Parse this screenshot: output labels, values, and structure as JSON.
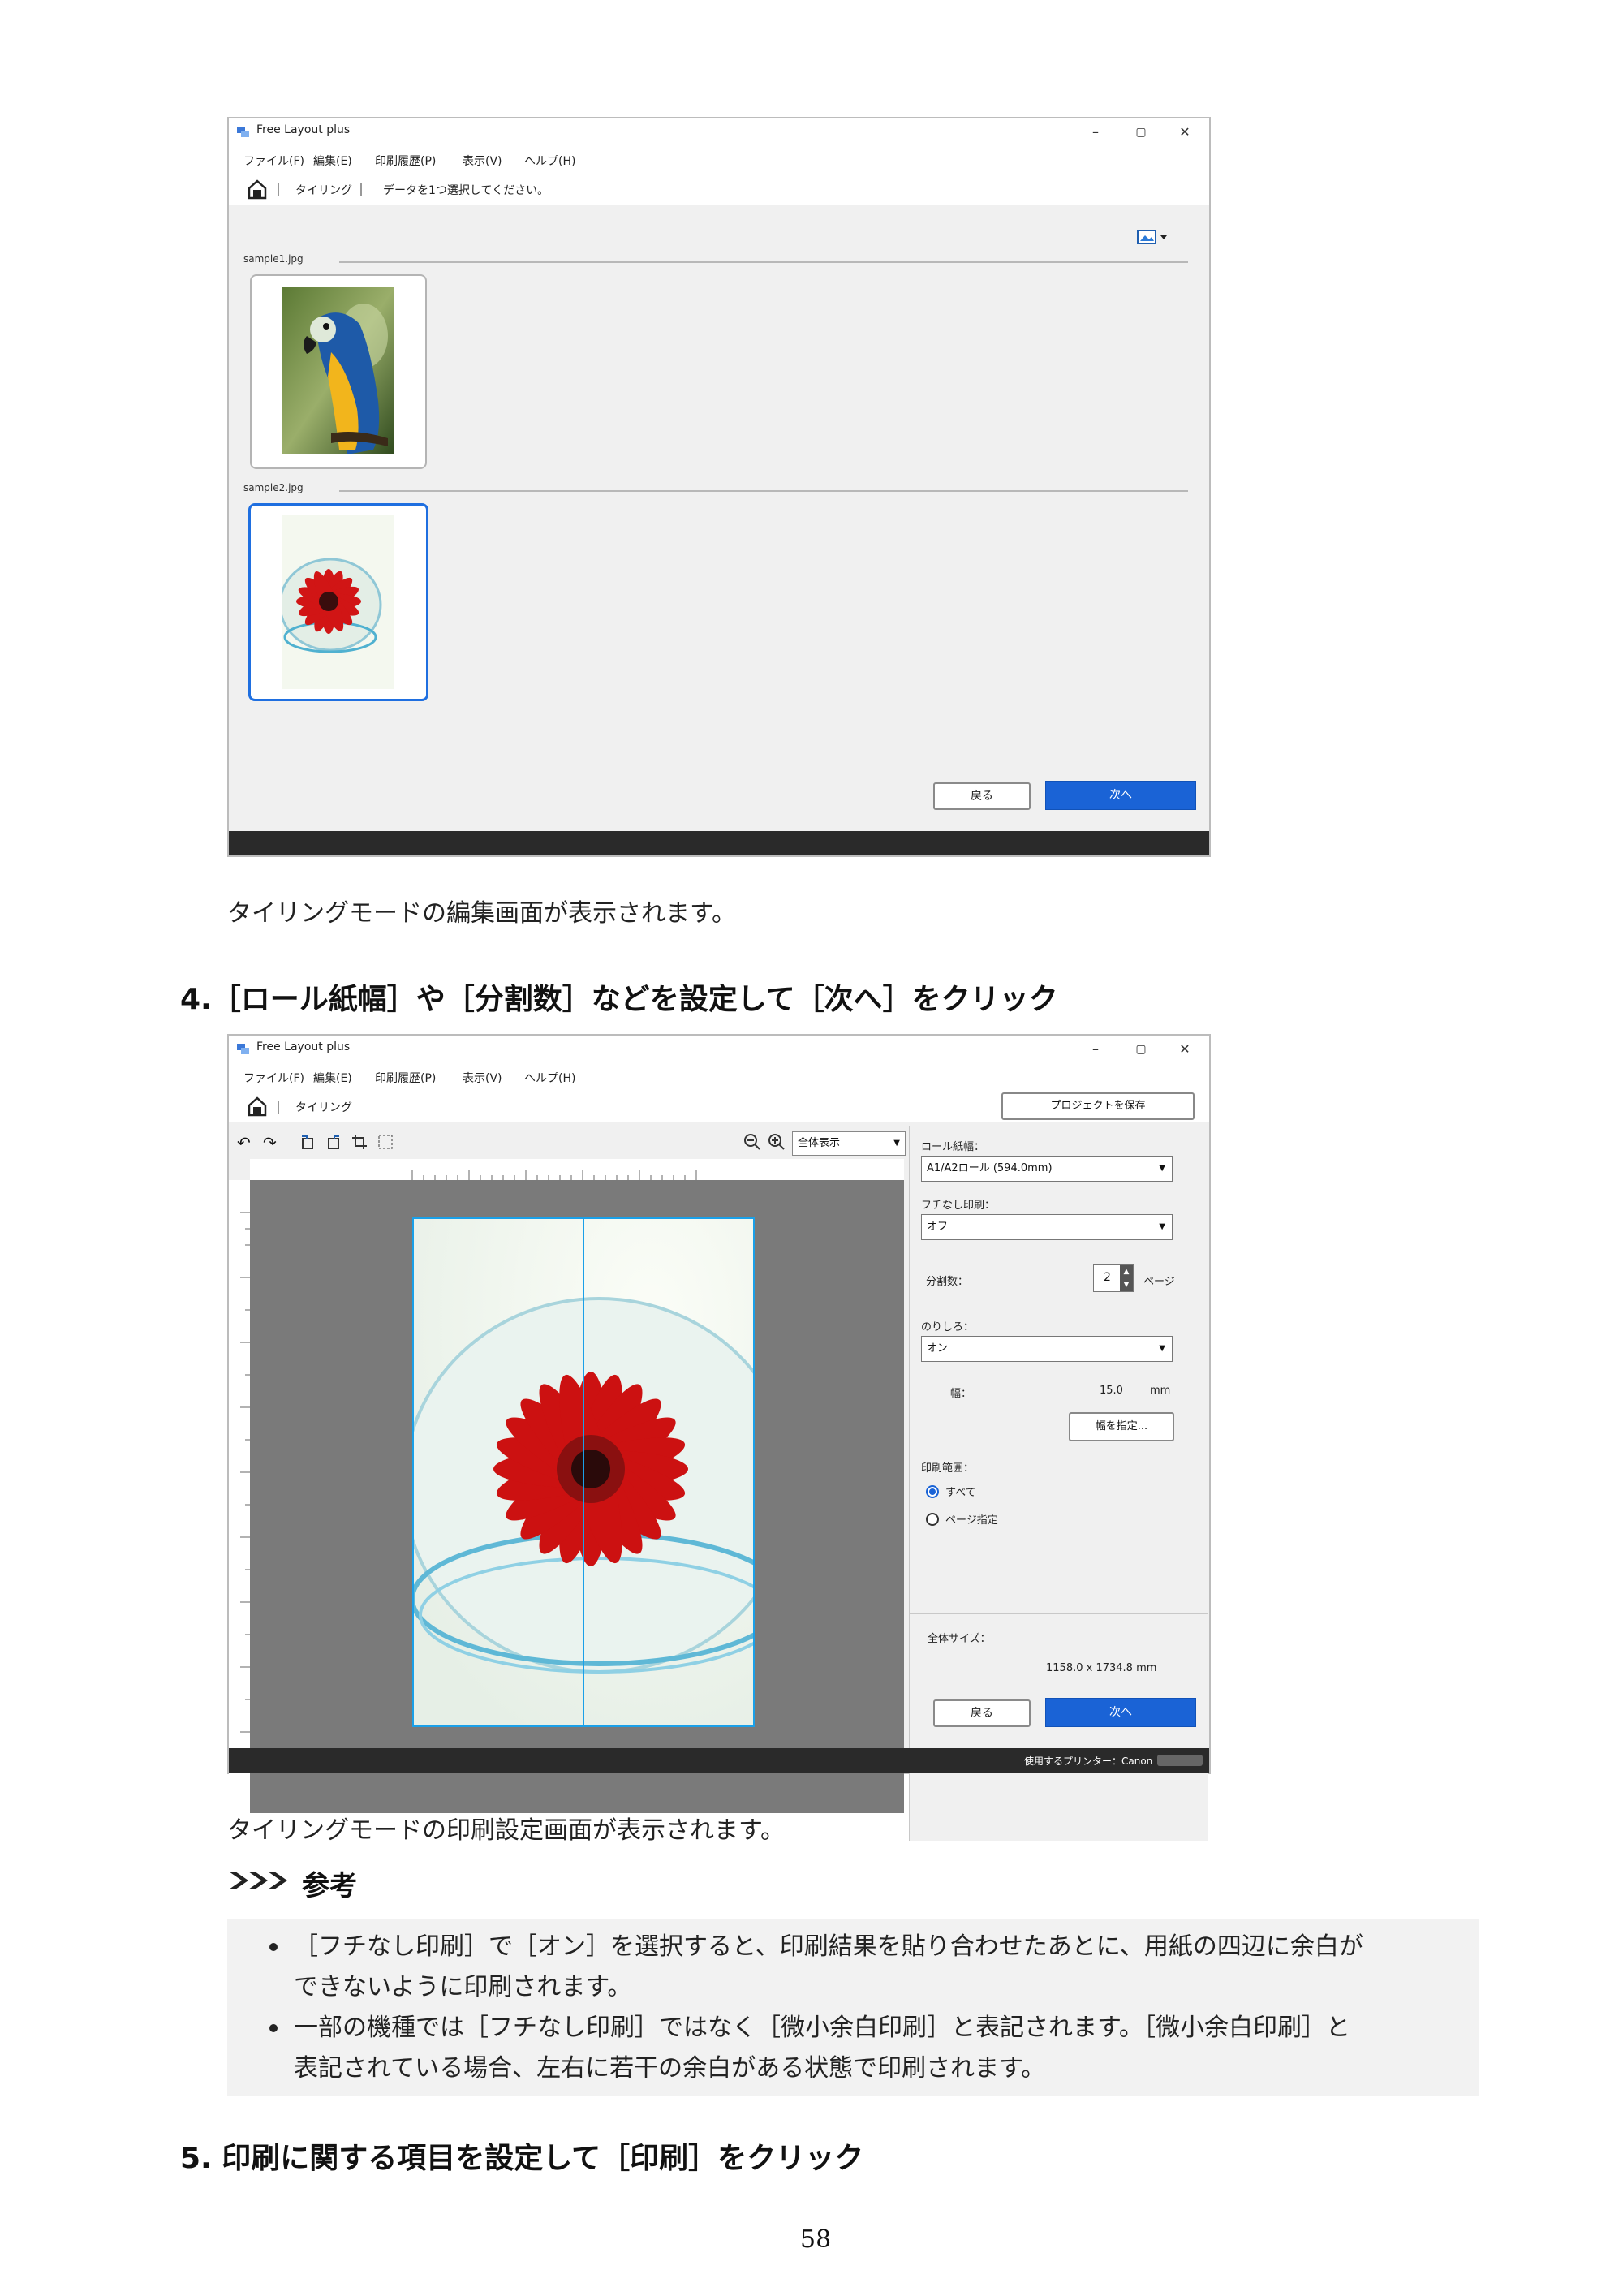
{
  "window1": {
    "app_title": "Free Layout plus",
    "controls": {
      "minimize": "–",
      "maximize": "▢",
      "close": "✕"
    },
    "menu": [
      "ファイル(F)",
      "編集(E)",
      "印刷履歴(P)",
      "表示(V)",
      "ヘルプ(H)"
    ],
    "breadcrumb": "タイリング",
    "instruction": "データを1つ選択してください。",
    "groups": [
      {
        "label": "sample1.jpg",
        "image": "parrot photo"
      },
      {
        "label": "sample2.jpg",
        "image": "red gerbera photo"
      }
    ],
    "back_label": "戻る",
    "next_label": "次へ"
  },
  "caption1": "タイリングモードの編集画面が表示されます。",
  "step4": "4.［ロール紙幅］や［分割数］などを設定して［次へ］をクリック",
  "window2": {
    "app_title": "Free Layout plus",
    "controls": {
      "minimize": "–",
      "maximize": "▢",
      "close": "✕"
    },
    "menu": [
      "ファイル(F)",
      "編集(E)",
      "印刷履歴(P)",
      "表示(V)",
      "ヘルプ(H)"
    ],
    "breadcrumb": "タイリング",
    "save_project_label": "プロジェクトを保存",
    "zoom_value": "全体表示",
    "panel": {
      "roll_width_label": "ロール紙幅：",
      "roll_width_value": "A1/A2ロール (594.0mm)",
      "borderless_label": "フチなし印刷：",
      "borderless_value": "オフ",
      "divisions_label": "分割数：",
      "divisions_value": "2",
      "divisions_unit": "ページ",
      "margin_label": "のりしろ：",
      "margin_value": "オン",
      "width_label": "幅：",
      "width_value": "15.0",
      "width_unit": "mm",
      "specify_width_label": "幅を指定...",
      "print_range_label": "印刷範囲：",
      "range_all_label": "すべて",
      "range_pages_label": "ページ指定",
      "total_size_label": "全体サイズ：",
      "total_size_value": "1158.0 x 1734.8 mm"
    },
    "back_label": "戻る",
    "next_label": "次へ",
    "printer_label": "使用するプリンター：Canon"
  },
  "caption2": "タイリングモードの印刷設定画面が表示されます。",
  "note": {
    "heading": "参考",
    "items": [
      [
        "［フチなし印刷］で［オン］を選択すると、印刷結果を貼り合わせたあとに、用紙の四辺に余白が",
        "できないように印刷されます。"
      ],
      [
        "一部の機種では［フチなし印刷］ではなく［微小余白印刷］と表記されます。［微小余白印刷］と",
        "表記されている場合、左右に若干の余白がある状態で印刷されます。"
      ]
    ]
  },
  "step5": "5. 印刷に関する項目を設定して［印刷］をクリック",
  "page_number": "58"
}
